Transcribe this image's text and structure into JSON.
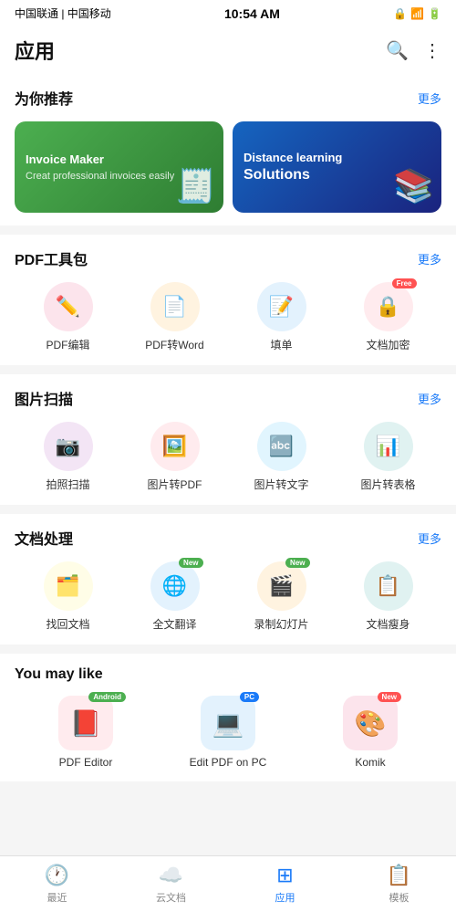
{
  "statusBar": {
    "left": "中国联通 | 中国移动",
    "time": "10:54 AM",
    "icons": "🔒◻ ▶ 📶 📶 🔋"
  },
  "header": {
    "title": "应用",
    "searchLabel": "搜索",
    "moreLabel": "更多选项"
  },
  "recommend": {
    "sectionTitle": "为你推荐",
    "moreLabel": "更多",
    "cards": [
      {
        "id": "invoice",
        "title": "Invoice Maker",
        "subtitle": "Creat professional invoices easily",
        "colorClass": "banner-green",
        "icon": "🧾"
      },
      {
        "id": "distance",
        "title": "Distance learning",
        "subtitle": "Solutions",
        "colorClass": "banner-blue",
        "icon": "📚"
      }
    ]
  },
  "pdfTools": {
    "sectionTitle": "PDF工具包",
    "moreLabel": "更多",
    "items": [
      {
        "id": "pdf-edit",
        "label": "PDF编辑",
        "icon": "✏️",
        "colorClass": "ic-pink",
        "badge": null
      },
      {
        "id": "pdf-word",
        "label": "PDF转Word",
        "icon": "📄",
        "colorClass": "ic-orange",
        "badge": null
      },
      {
        "id": "fill-form",
        "label": "填单",
        "icon": "📝",
        "colorClass": "ic-blue",
        "badge": null
      },
      {
        "id": "doc-encrypt",
        "label": "文档加密",
        "icon": "🔒",
        "colorClass": "ic-red",
        "badge": "Free"
      }
    ]
  },
  "imageScan": {
    "sectionTitle": "图片扫描",
    "moreLabel": "更多",
    "items": [
      {
        "id": "photo-scan",
        "label": "拍照扫描",
        "icon": "📷",
        "colorClass": "ic-purple",
        "badge": null
      },
      {
        "id": "img-pdf",
        "label": "图片转PDF",
        "icon": "🖼️",
        "colorClass": "ic-red",
        "badge": null
      },
      {
        "id": "img-text",
        "label": "图片转文字",
        "icon": "🔤",
        "colorClass": "ic-light-blue",
        "badge": null
      },
      {
        "id": "img-table",
        "label": "图片转表格",
        "icon": "📊",
        "colorClass": "ic-teal",
        "badge": null
      }
    ]
  },
  "docProcess": {
    "sectionTitle": "文档处理",
    "moreLabel": "更多",
    "items": [
      {
        "id": "recover-doc",
        "label": "找回文档",
        "icon": "🗂️",
        "colorClass": "ic-yellow",
        "badge": null
      },
      {
        "id": "translate",
        "label": "全文翻译",
        "icon": "🌐",
        "colorClass": "ic-blue",
        "badge": "New"
      },
      {
        "id": "record-slide",
        "label": "录制幻灯片",
        "icon": "🎬",
        "colorClass": "ic-orange",
        "badge": "New"
      },
      {
        "id": "slim-doc",
        "label": "文档瘦身",
        "icon": "📋",
        "colorClass": "ic-teal",
        "badge": null
      }
    ]
  },
  "youMayLike": {
    "sectionTitle": "You may like",
    "items": [
      {
        "id": "pdf-editor",
        "label": "PDF Editor",
        "icon": "📕",
        "colorClass": "app-icon-red",
        "badge": "Android",
        "badgeColor": "badge-green"
      },
      {
        "id": "edit-pdf-pc",
        "label": "Edit PDF on PC",
        "icon": "💻",
        "colorClass": "app-icon-blue-dark",
        "badge": "PC",
        "badgeColor": "badge-blue"
      },
      {
        "id": "komik",
        "label": "Komik",
        "icon": "🎨",
        "colorClass": "app-icon-pink",
        "badge": "New",
        "badgeColor": ""
      }
    ]
  },
  "bottomNav": [
    {
      "id": "recent",
      "label": "最近",
      "icon": "🕐",
      "active": false
    },
    {
      "id": "cloud",
      "label": "云文档",
      "icon": "☁️",
      "active": false
    },
    {
      "id": "apps",
      "label": "应用",
      "icon": "⊞",
      "active": true
    },
    {
      "id": "template",
      "label": "模板",
      "icon": "📋",
      "active": false
    }
  ]
}
